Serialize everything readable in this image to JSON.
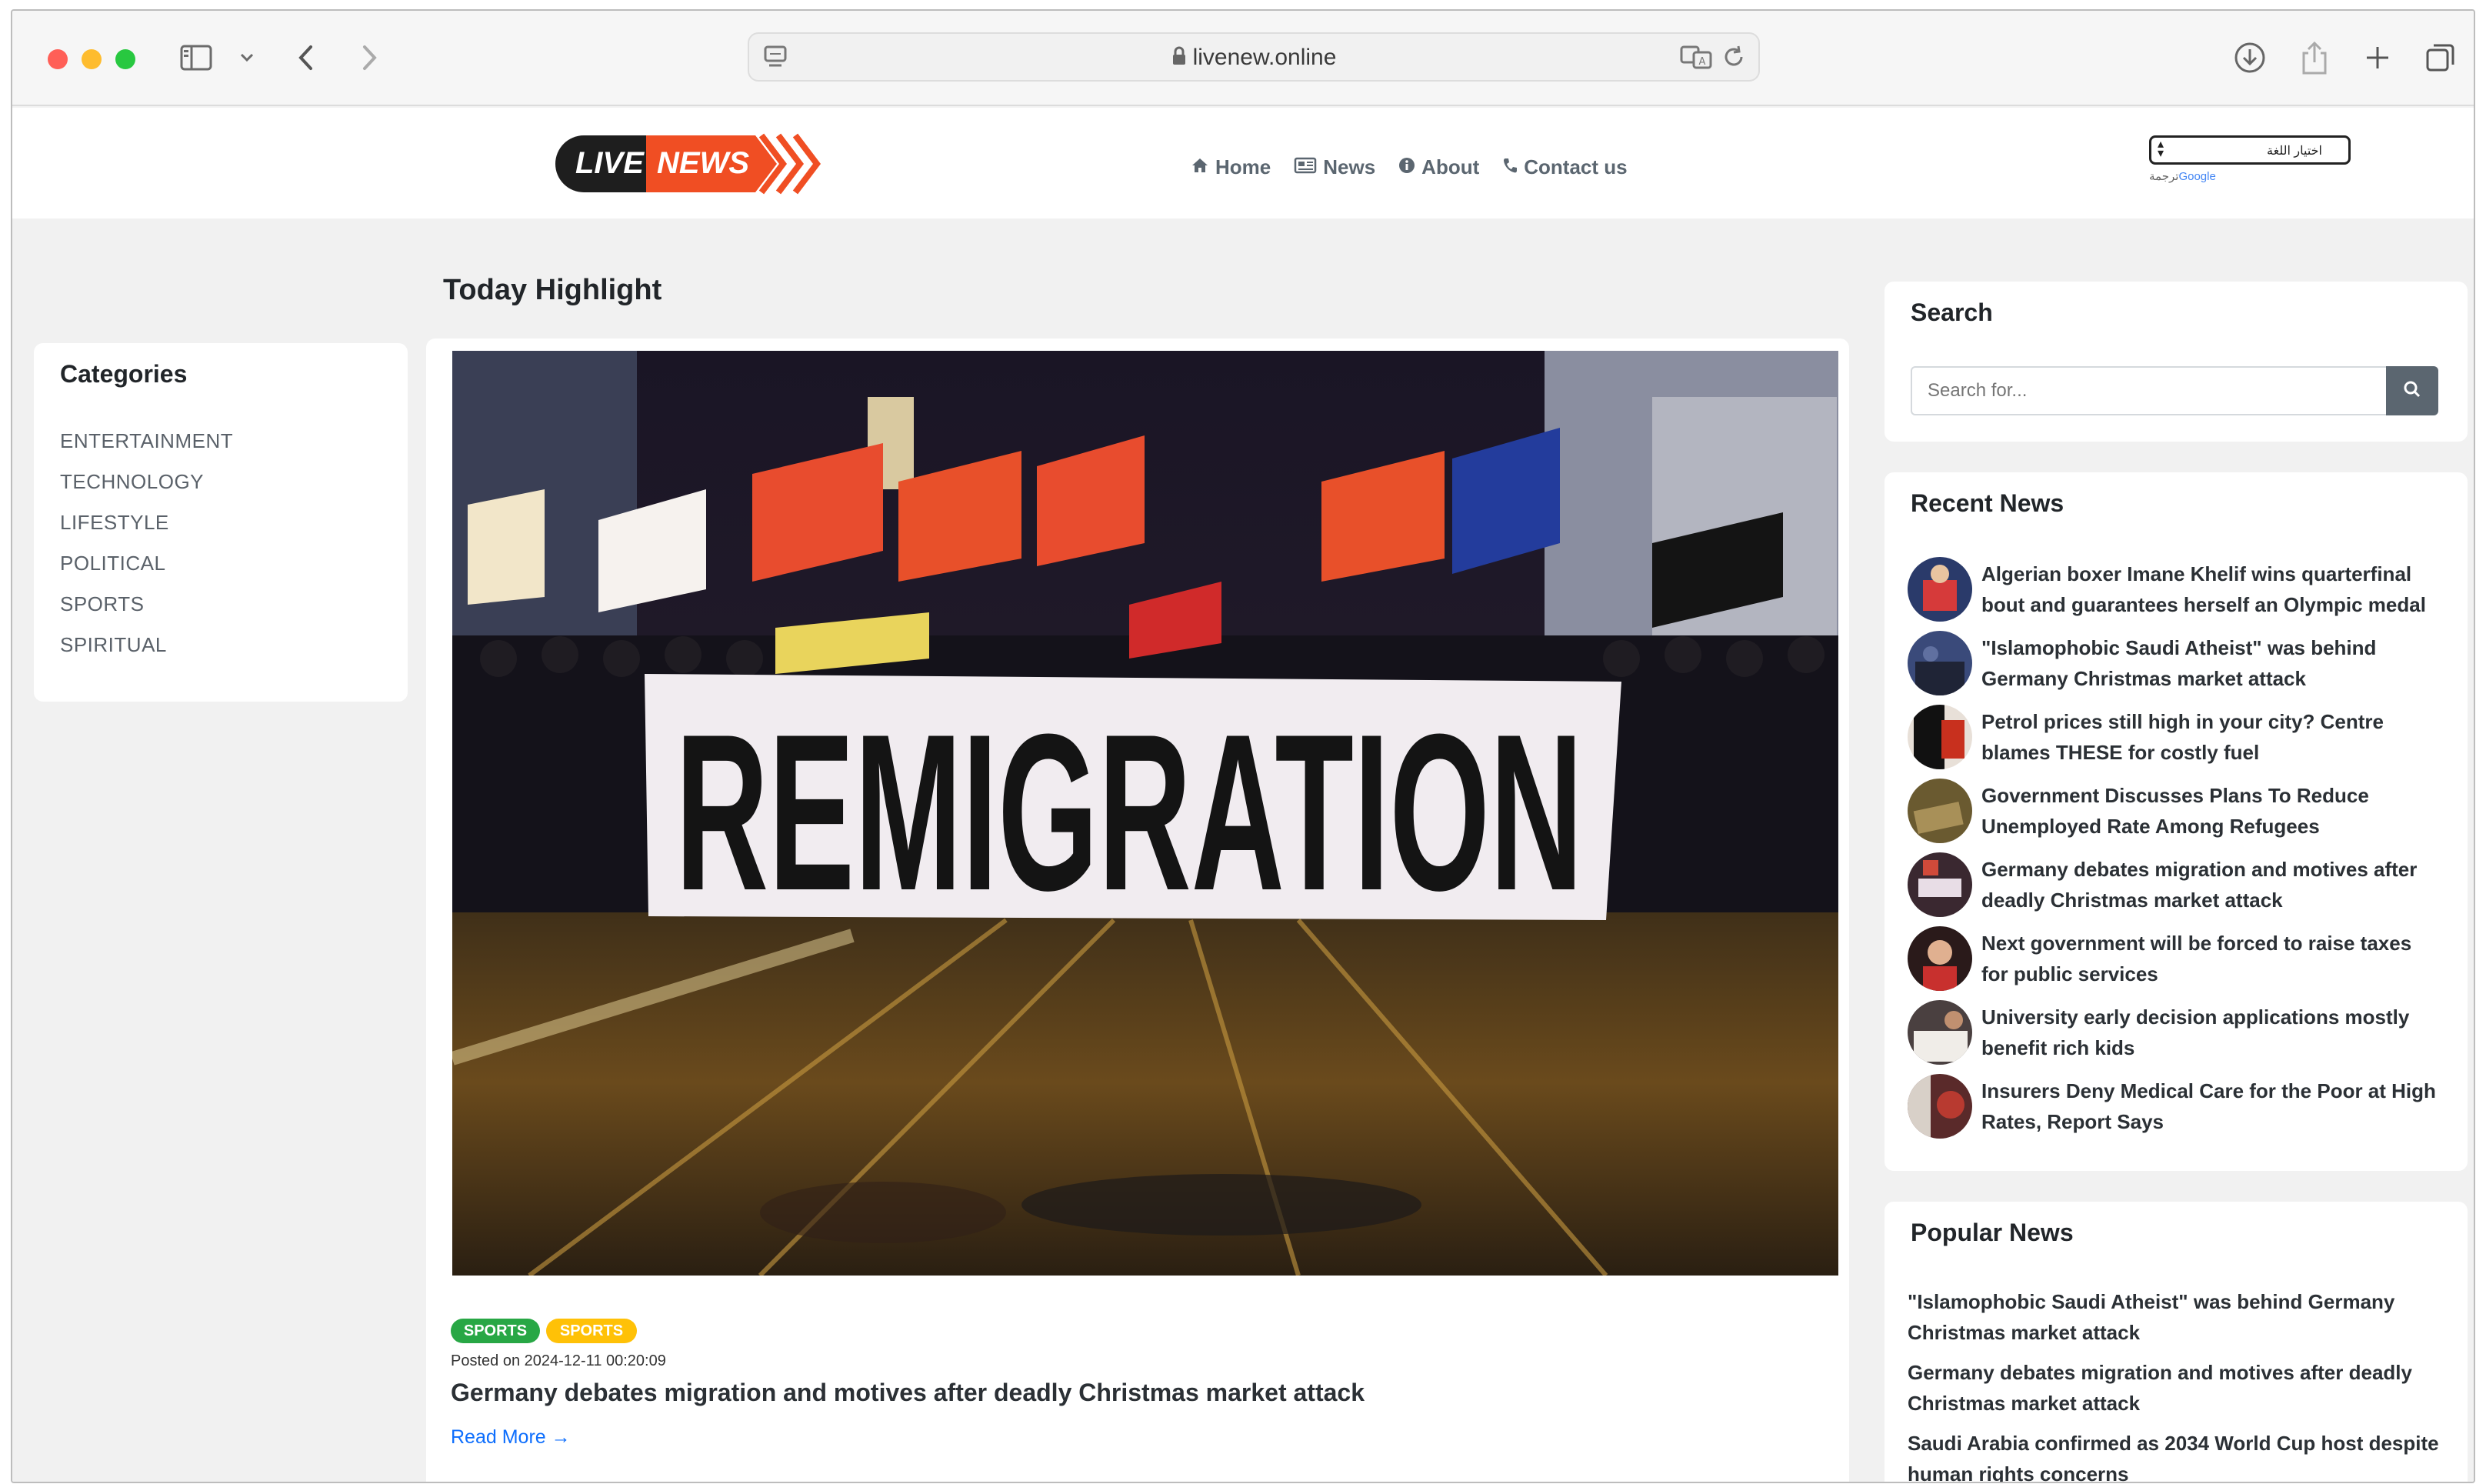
{
  "browser": {
    "url": "livenew.online",
    "lock_icon": "lock-icon",
    "colors": {
      "close": "#ff5f57",
      "minimize": "#febc2e",
      "zoom": "#28c840"
    }
  },
  "site": {
    "logo": {
      "live": "LIVE",
      "news": "NEWS"
    },
    "nav": [
      {
        "label": "Home",
        "icon": "home-icon"
      },
      {
        "label": "News",
        "icon": "newspaper-icon"
      },
      {
        "label": "About",
        "icon": "info-icon"
      },
      {
        "label": "Contact us",
        "icon": "phone-icon"
      }
    ],
    "language": {
      "selected": "اختيار اللغة",
      "translate_prefix": "ترجمة",
      "translate_brand": "Google"
    }
  },
  "categories": {
    "title": "Categories",
    "items": [
      "ENTERTAINMENT",
      "TECHNOLOGY",
      "LIFESTYLE",
      "POLITICAL",
      "SPORTS",
      "SPIRITUAL"
    ]
  },
  "highlight": {
    "section_title": "Today Highlight",
    "image_banner_text": "REMIGRATION",
    "badges": [
      {
        "label": "SPORTS",
        "color": "#28a745"
      },
      {
        "label": "SPORTS",
        "color": "#ffc107"
      }
    ],
    "posted": "Posted on 2024-12-11 00:20:09",
    "headline": "Germany debates migration and motives after deadly Christmas market attack",
    "read_more": "Read More →"
  },
  "search": {
    "title": "Search",
    "placeholder": "Search for...",
    "button_icon": "search-icon"
  },
  "recent_news": {
    "title": "Recent News",
    "items": [
      {
        "title": "Algerian boxer Imane Khelif wins quarterfinal bout and guarantees herself an Olympic medal"
      },
      {
        "title": "\"Islamophobic Saudi Atheist\" was behind Germany Christmas market attack"
      },
      {
        "title": "Petrol prices still high in your city? Centre blames THESE for costly fuel"
      },
      {
        "title": "Government Discusses Plans To Reduce Unemployed Rate Among Refugees"
      },
      {
        "title": "Germany debates migration and motives after deadly Christmas market attack"
      },
      {
        "title": "Next government will be forced to raise taxes for public services"
      },
      {
        "title": "University early decision applications mostly benefit rich kids"
      },
      {
        "title": "Insurers Deny Medical Care for the Poor at High Rates, Report Says"
      }
    ]
  },
  "popular_news": {
    "title": "Popular News",
    "items": [
      "\"Islamophobic Saudi Atheist\" was behind Germany Christmas market attack",
      "Germany debates migration and motives after deadly Christmas market attack",
      "Saudi Arabia confirmed as 2034 World Cup host despite human rights concerns"
    ]
  }
}
